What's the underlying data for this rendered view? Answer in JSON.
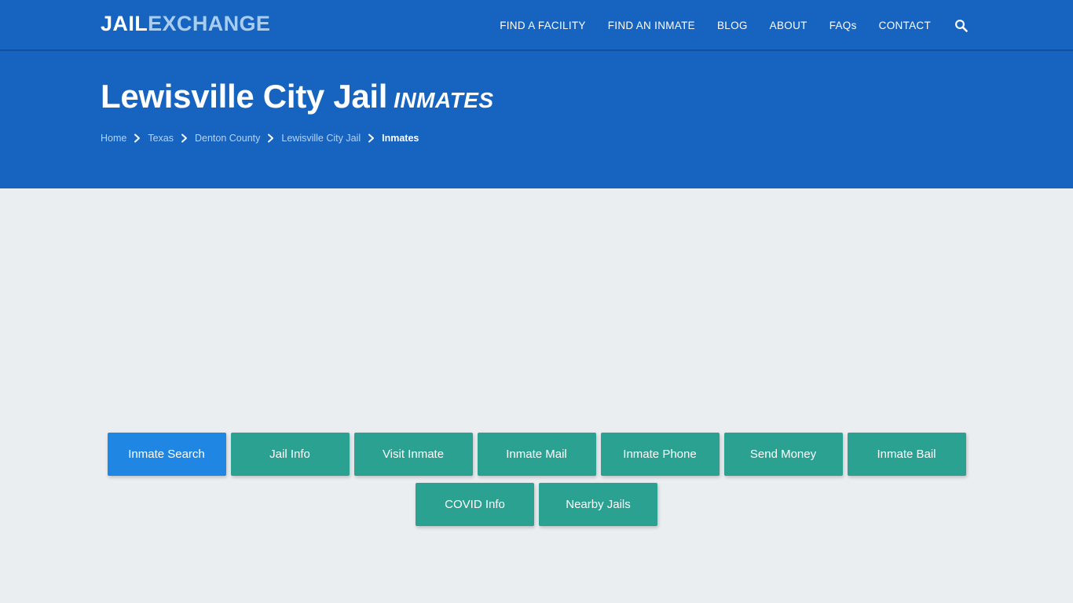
{
  "site": {
    "logo_primary": "JAIL",
    "logo_secondary": "EXCHANGE"
  },
  "nav": {
    "items": [
      {
        "label": "FIND A FACILITY",
        "name": "nav-find-a-facility"
      },
      {
        "label": "FIND AN INMATE",
        "name": "nav-find-an-inmate"
      },
      {
        "label": "BLOG",
        "name": "nav-blog"
      },
      {
        "label": "ABOUT",
        "name": "nav-about"
      },
      {
        "label": "FAQs",
        "name": "nav-faqs"
      },
      {
        "label": "CONTACT",
        "name": "nav-contact"
      }
    ],
    "search_icon": "search-icon"
  },
  "hero": {
    "title": "Lewisville City Jail",
    "title_suffix": "INMATES",
    "breadcrumb": [
      {
        "label": "Home",
        "current": false
      },
      {
        "label": "Texas",
        "current": false
      },
      {
        "label": "Denton County",
        "current": false
      },
      {
        "label": "Lewisville City Jail",
        "current": false
      },
      {
        "label": "Inmates",
        "current": true
      }
    ],
    "separator_icon": "chevron-right-icon"
  },
  "facility_tabs": {
    "row1": [
      {
        "label": "Inmate Search",
        "active": true
      },
      {
        "label": "Jail Info",
        "active": false
      },
      {
        "label": "Visit Inmate",
        "active": false
      },
      {
        "label": "Inmate Mail",
        "active": false
      },
      {
        "label": "Inmate Phone",
        "active": false
      },
      {
        "label": "Send Money",
        "active": false
      },
      {
        "label": "Inmate Bail",
        "active": false
      }
    ],
    "row2": [
      {
        "label": "COVID Info",
        "active": false
      },
      {
        "label": "Nearby Jails",
        "active": false
      }
    ]
  },
  "colors": {
    "header_blue": "#1663c0",
    "accent_blue": "#1f86e4",
    "teal": "#2aa191",
    "page_background": "#eaeef1",
    "logo_secondary": "#a9cdef",
    "breadcrumb_link": "#bad3ef"
  }
}
